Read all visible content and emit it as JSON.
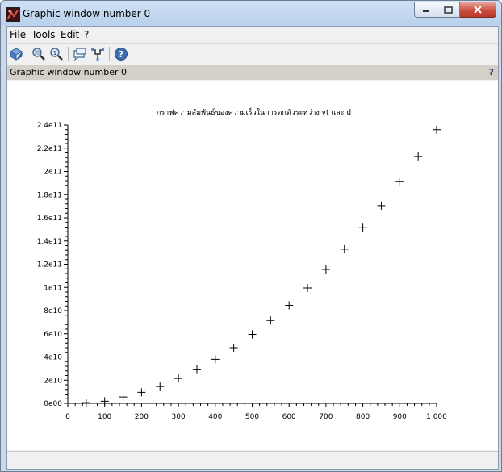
{
  "window": {
    "title": "Graphic window number 0",
    "controls": {
      "minimize": "minimize-icon",
      "maximize": "maximize-icon",
      "close": "close-icon"
    }
  },
  "menu": [
    "File",
    "Tools",
    "Edit",
    "?"
  ],
  "toolbar": [
    {
      "name": "rotate-icon"
    },
    {
      "name": "zoom-in-icon"
    },
    {
      "name": "zoom-reset-icon"
    },
    {
      "name": "datatip-icon"
    },
    {
      "name": "edit-curve-icon"
    },
    {
      "name": "help-icon"
    }
  ],
  "infobar": {
    "label": "Graphic window number 0",
    "help": "?"
  },
  "chart_data": {
    "type": "scatter",
    "title": "กราฟความสัมพันธ์ของความเร็วในการตกตัวระหว่าง vt และ d",
    "xlabel": "",
    "ylabel": "",
    "marker": "+",
    "xlim": [
      0,
      1000
    ],
    "ylim": [
      0,
      240000000000
    ],
    "x_ticks": [
      "0",
      "100",
      "200",
      "300",
      "400",
      "500",
      "600",
      "700",
      "800",
      "900",
      "1 000"
    ],
    "y_ticks": [
      "0e00",
      "2e10",
      "4e10",
      "6e10",
      "8e10",
      "1e11",
      "1.2e11",
      "1.4e11",
      "1.6e11",
      "1.8e11",
      "2e11",
      "2.2e11",
      "2.4e11"
    ],
    "x": [
      50,
      100,
      150,
      200,
      250,
      300,
      350,
      400,
      450,
      500,
      550,
      600,
      650,
      700,
      750,
      800,
      850,
      900,
      950,
      1000
    ],
    "y": [
      600000000,
      1800000000,
      5500000000,
      9500000000,
      14500000000,
      21500000000,
      29500000000,
      38000000000,
      48000000000,
      59500000000,
      71500000000,
      84500000000,
      99500000000,
      115500000000,
      133000000000,
      151500000000,
      170500000000,
      191500000000,
      213000000000,
      236000000000
    ],
    "grid": false,
    "color": "#000000"
  }
}
